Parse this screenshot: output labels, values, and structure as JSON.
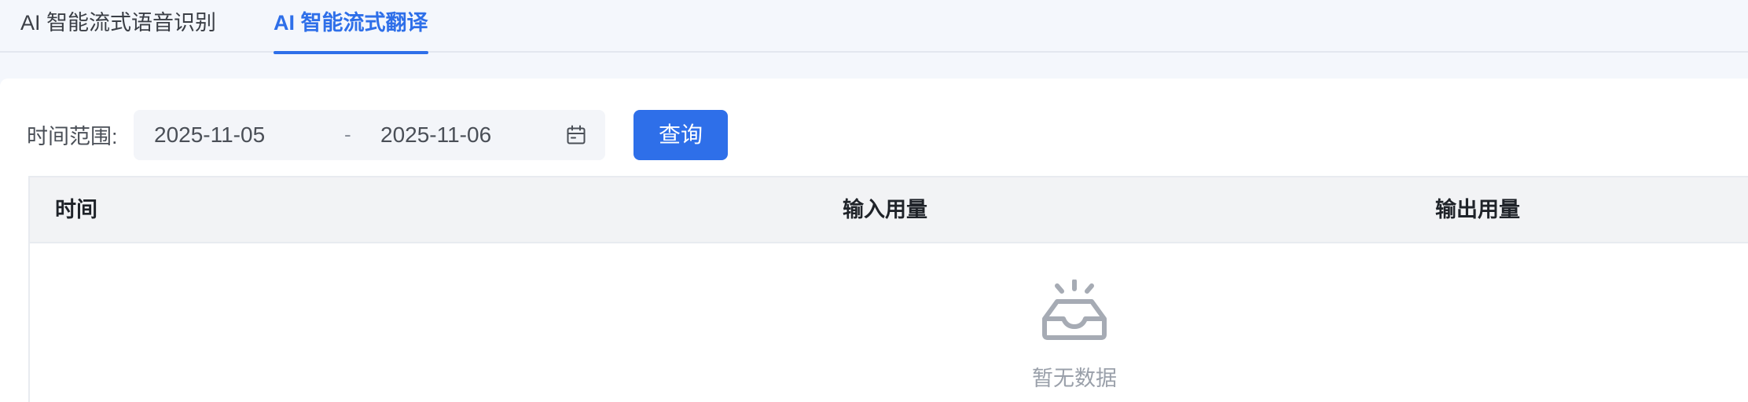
{
  "tabs": [
    {
      "label": "AI 智能流式语音识别",
      "active": false
    },
    {
      "label": "AI 智能流式翻译",
      "active": true
    }
  ],
  "filter": {
    "label": "时间范围:",
    "start_date": "2025-11-05",
    "separator": "-",
    "end_date": "2025-11-06",
    "calendar_icon": "calendar-icon",
    "query_button": "查询"
  },
  "table": {
    "columns": [
      "时间",
      "输入用量",
      "输出用量"
    ],
    "rows": [],
    "empty_icon": "inbox-empty-icon",
    "empty_text": "暂无数据"
  },
  "colors": {
    "accent": "#2e6fe9",
    "page_bg": "#f4f7fc",
    "header_bg": "#f2f3f5",
    "muted_text": "#9aa0aa"
  }
}
